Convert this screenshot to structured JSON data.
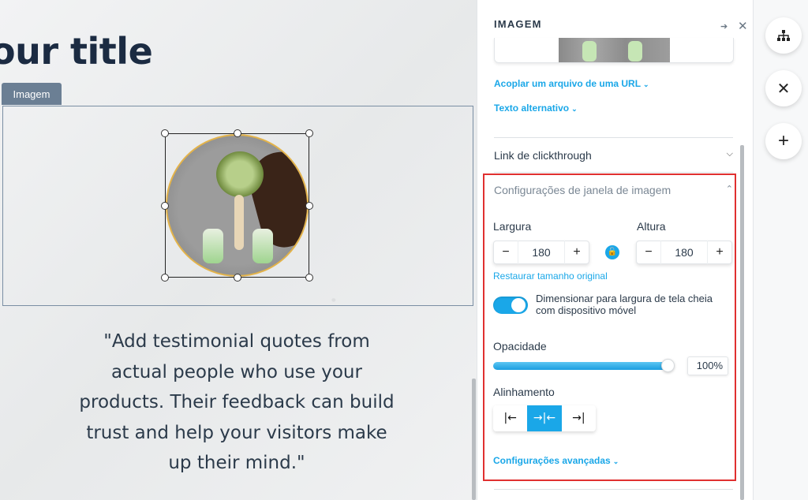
{
  "canvas": {
    "title": "our title",
    "image_tag": "Imagem",
    "quote": "\"Add testimonial quotes from actual people who use your products. Their feedback can build trust and help your visitors make up their mind.\""
  },
  "panel": {
    "title": "IMAGEM",
    "attach_url_link": "Acoplar um arquivo de uma URL",
    "alt_text_link": "Texto alternativo",
    "clickthrough_label": "Link de clickthrough",
    "window_settings_label": "Configurações de janela de imagem",
    "width_label": "Largura",
    "height_label": "Altura",
    "width_value": "180",
    "height_value": "180",
    "minus": "−",
    "plus": "+",
    "restore_label": "Restaurar tamanho original",
    "mobile_toggle_label": "Dimensionar para largura de tela cheia com dispositivo móvel",
    "mobile_toggle_on": true,
    "opacity_label": "Opacidade",
    "opacity_value": "100%",
    "opacity_level": 1.0,
    "alignment_label": "Alinhamento",
    "alignment_options": [
      "left",
      "center",
      "right"
    ],
    "alignment_selected": "center",
    "advanced_link": "Configurações avançadas"
  },
  "toolbar": {
    "buttons": [
      "sitemap-icon",
      "close-icon",
      "add-icon"
    ]
  },
  "colors": {
    "accent": "#1aa7e8",
    "highlight_border": "#e03030",
    "title_text": "#1b2b42"
  }
}
